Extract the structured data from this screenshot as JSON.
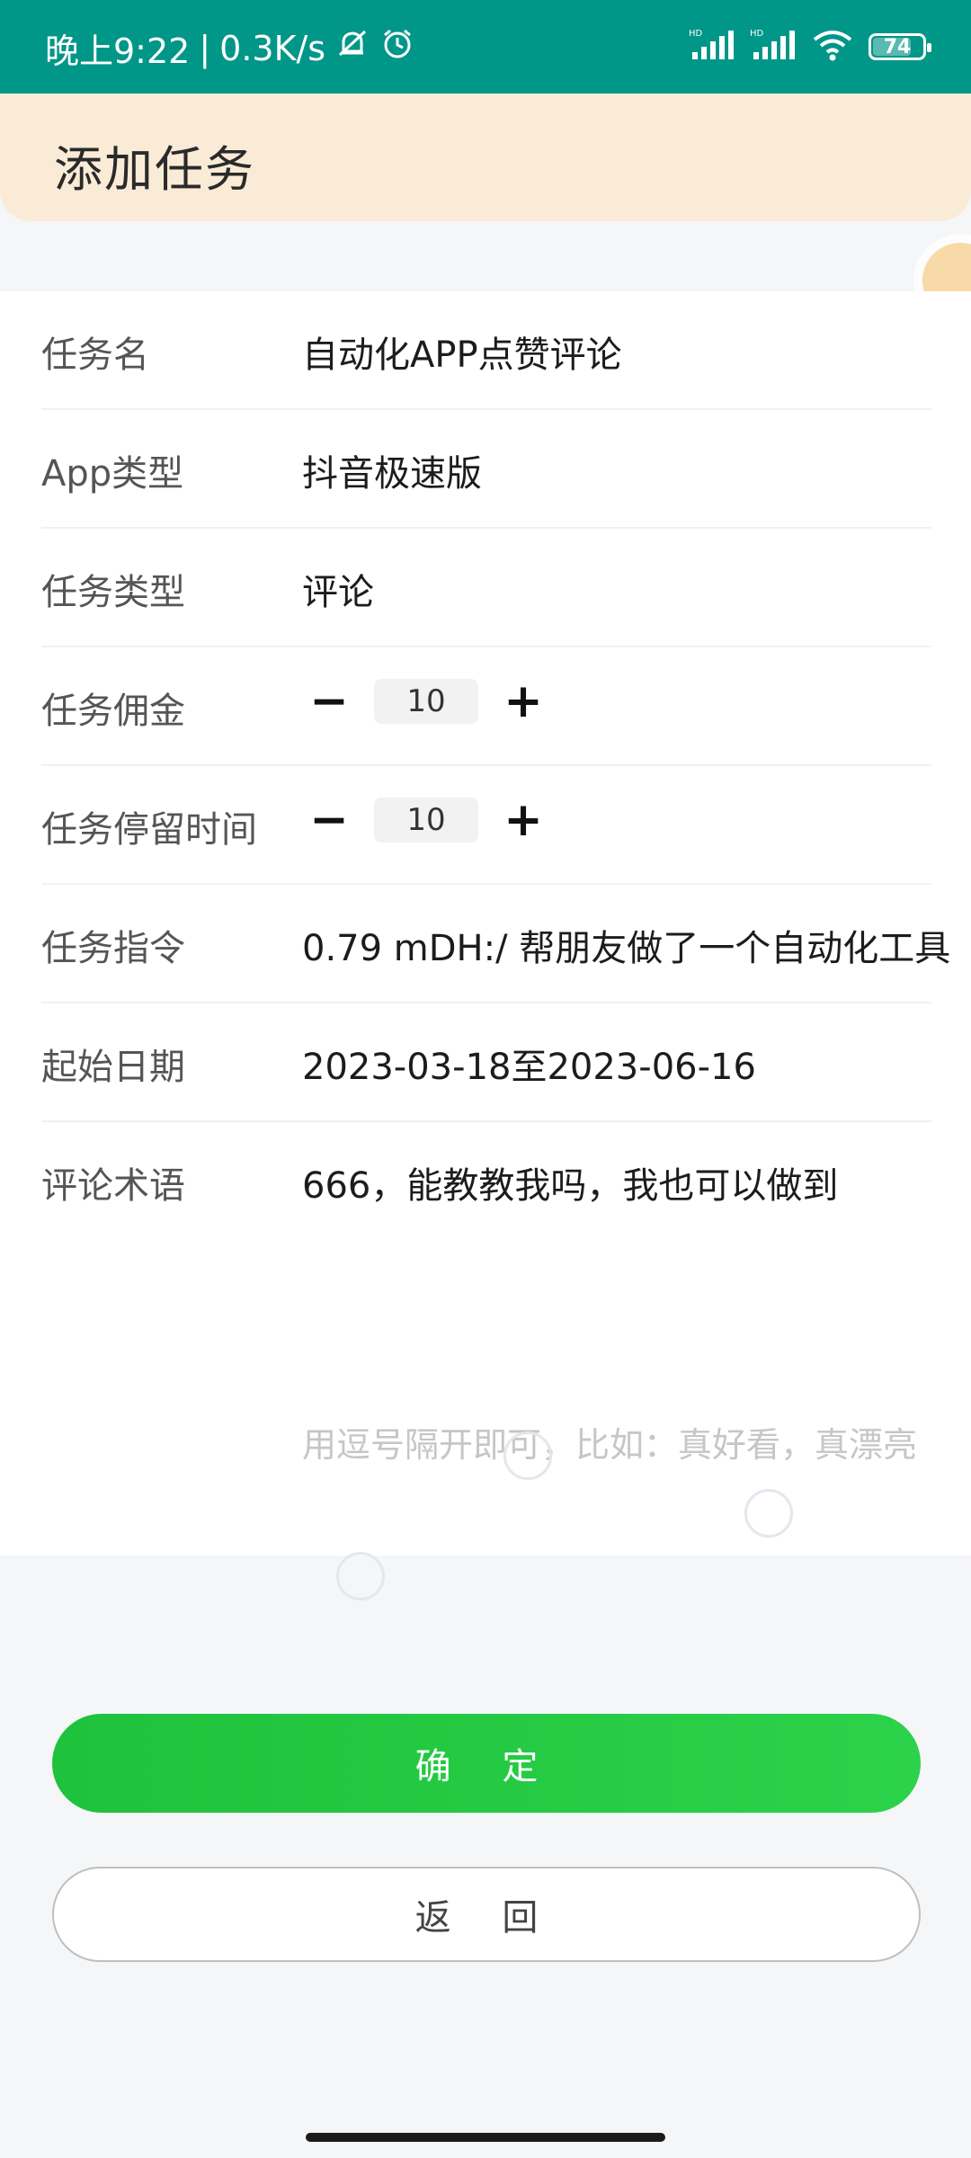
{
  "status_bar": {
    "time": "晚上9:22",
    "separator": "|",
    "network_speed": "0.3K/s",
    "battery_level": "74"
  },
  "header": {
    "title": "添加任务"
  },
  "form": {
    "task_name": {
      "label": "任务名",
      "value": "自动化APP点赞评论"
    },
    "app_type": {
      "label": "App类型",
      "value": "抖音极速版"
    },
    "task_type": {
      "label": "任务类型",
      "value": "评论"
    },
    "commission": {
      "label": "任务佣金",
      "value": "10",
      "minus": "−",
      "plus": "+"
    },
    "stay_time": {
      "label": "任务停留时间",
      "value": "10",
      "minus": "−",
      "plus": "+"
    },
    "instruction": {
      "label": "任务指令",
      "value": "0.79 mDH:/  帮朋友做了一个自动化工具"
    },
    "date_range": {
      "label": "起始日期",
      "value": "2023-03-18至2023-06-16"
    },
    "comment": {
      "label": "评论术语",
      "value": "666，能教教我吗，我也可以做到",
      "placeholder": "用逗号隔开即可，比如：真好看，真漂亮"
    }
  },
  "buttons": {
    "confirm": "确 定",
    "back": "返 回"
  },
  "colors": {
    "status_bar": "#009688",
    "header_bg": "#faebd7",
    "confirm": "#22c943"
  }
}
